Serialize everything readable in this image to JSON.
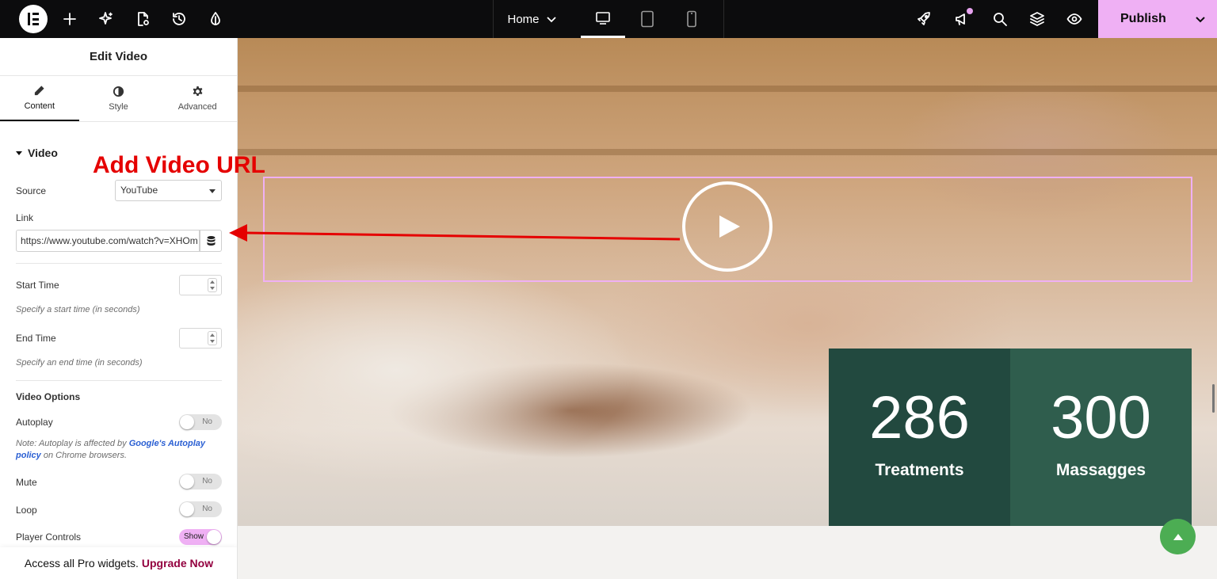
{
  "topbar": {
    "page_name": "Home",
    "publish_label": "Publish",
    "icons": [
      "elementor-logo",
      "add-icon",
      "ai-sparkle-icon",
      "page-settings-icon",
      "history-icon",
      "site-settings-icon",
      "rocket-icon",
      "announcement-icon",
      "search-icon",
      "structure-icon",
      "preview-icon"
    ],
    "devices": [
      "desktop",
      "tablet",
      "mobile"
    ]
  },
  "panel": {
    "title": "Edit Video",
    "tabs": [
      {
        "label": "Content",
        "icon": "pencil-icon",
        "active": true
      },
      {
        "label": "Style",
        "icon": "half-circle-icon",
        "active": false
      },
      {
        "label": "Advanced",
        "icon": "gear-icon",
        "active": false
      }
    ],
    "section": "Video",
    "source_label": "Source",
    "source_value": "YouTube",
    "link_label": "Link",
    "link_value": "https://www.youtube.com/watch?v=XHOm",
    "start_time_label": "Start Time",
    "start_time_hint": "Specify a start time (in seconds)",
    "end_time_label": "End Time",
    "end_time_hint": "Specify an end time (in seconds)",
    "video_options_label": "Video Options",
    "autoplay_label": "Autoplay",
    "autoplay_value": "No",
    "autoplay_note_prefix": "Note: Autoplay is affected by ",
    "autoplay_note_link": "Google's Autoplay policy",
    "autoplay_note_suffix": " on Chrome browsers.",
    "mute_label": "Mute",
    "mute_value": "No",
    "loop_label": "Loop",
    "loop_value": "No",
    "player_controls_label": "Player Controls",
    "player_controls_value": "Show",
    "upgrade_text": "Access all Pro widgets.",
    "upgrade_link": "Upgrade Now"
  },
  "annotation": {
    "text": "Add Video URL",
    "color": "#e50000"
  },
  "canvas": {
    "stats": [
      {
        "number": "286",
        "caption": "Treatments",
        "color": "#22493f"
      },
      {
        "number": "300",
        "caption": "Massagges",
        "color": "#2f5d4d"
      }
    ]
  },
  "colors": {
    "accent": "#efb0f4",
    "scroll_top": "#4cad53",
    "topbar": "#0c0c0d"
  }
}
